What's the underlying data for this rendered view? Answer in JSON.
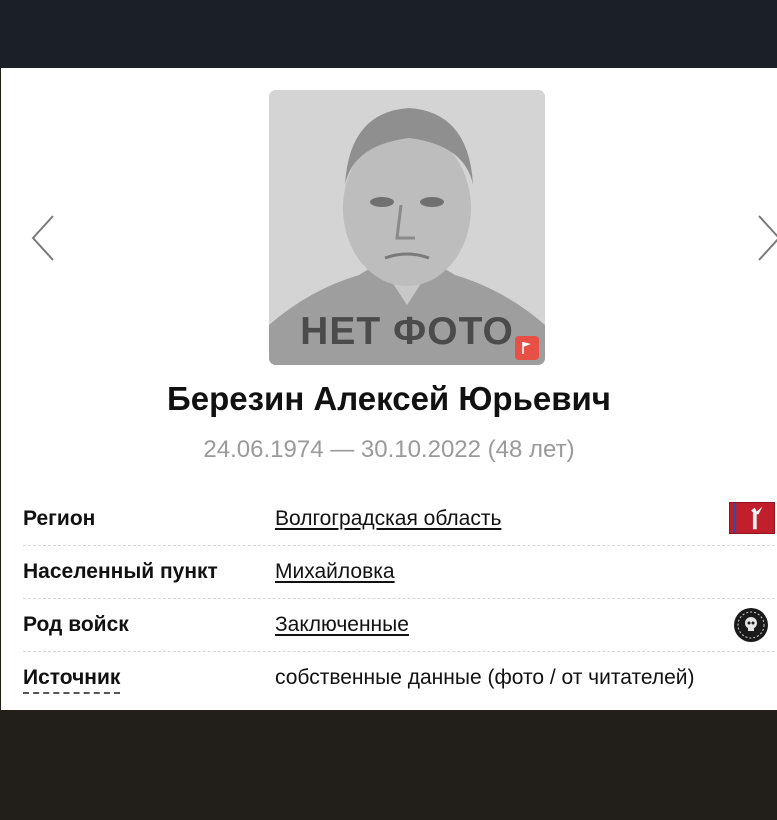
{
  "photo": {
    "overlay_text": "НЕТ ФОТО"
  },
  "person": {
    "name": "Березин Алексей Юрьевич",
    "dates": "24.06.1974 — 30.10.2022 (48 лет)"
  },
  "details": [
    {
      "label": "Регион",
      "value": "Волгоградская область",
      "link": true,
      "icon": "region-flag-icon"
    },
    {
      "label": "Населенный пункт",
      "value": "Михайловка",
      "link": true
    },
    {
      "label": "Род войск",
      "value": "Заключенные",
      "link": true,
      "icon": "skull-emblem-icon"
    },
    {
      "label": "Источник",
      "value": "собственные данные (фото / от читателей)",
      "link": false
    }
  ],
  "colors": {
    "accent_red": "#e84f45",
    "flag_red": "#c21f2d",
    "topbar": "#1b1f27"
  }
}
